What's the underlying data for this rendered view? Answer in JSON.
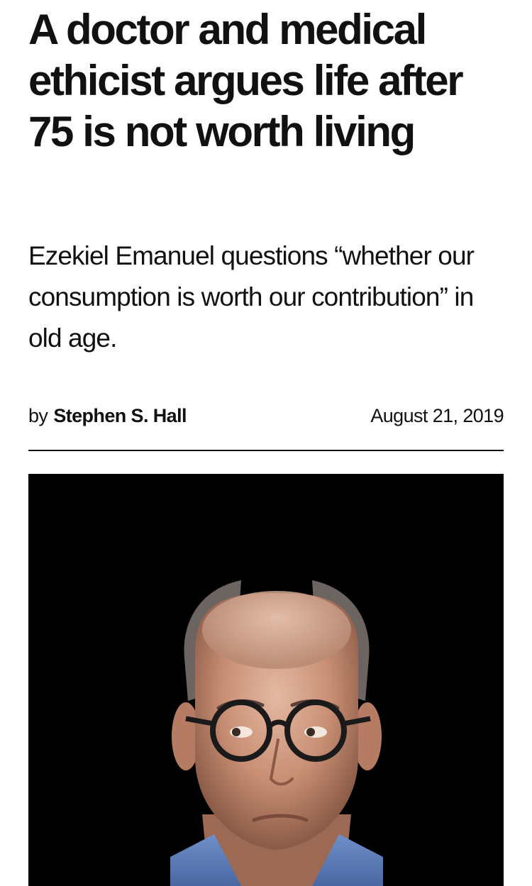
{
  "article": {
    "headline": "A doctor and medical ethicist argues life after 75 is not worth living",
    "dek": "Ezekiel Emanuel questions “whether our consumption is worth our contribution” in old age.",
    "byline_prefix": "by",
    "author": "Stephen S. Hall",
    "date": "August 21, 2019"
  },
  "colors": {
    "text": "#111111",
    "background": "#ffffff",
    "photo_background": "#000000"
  }
}
